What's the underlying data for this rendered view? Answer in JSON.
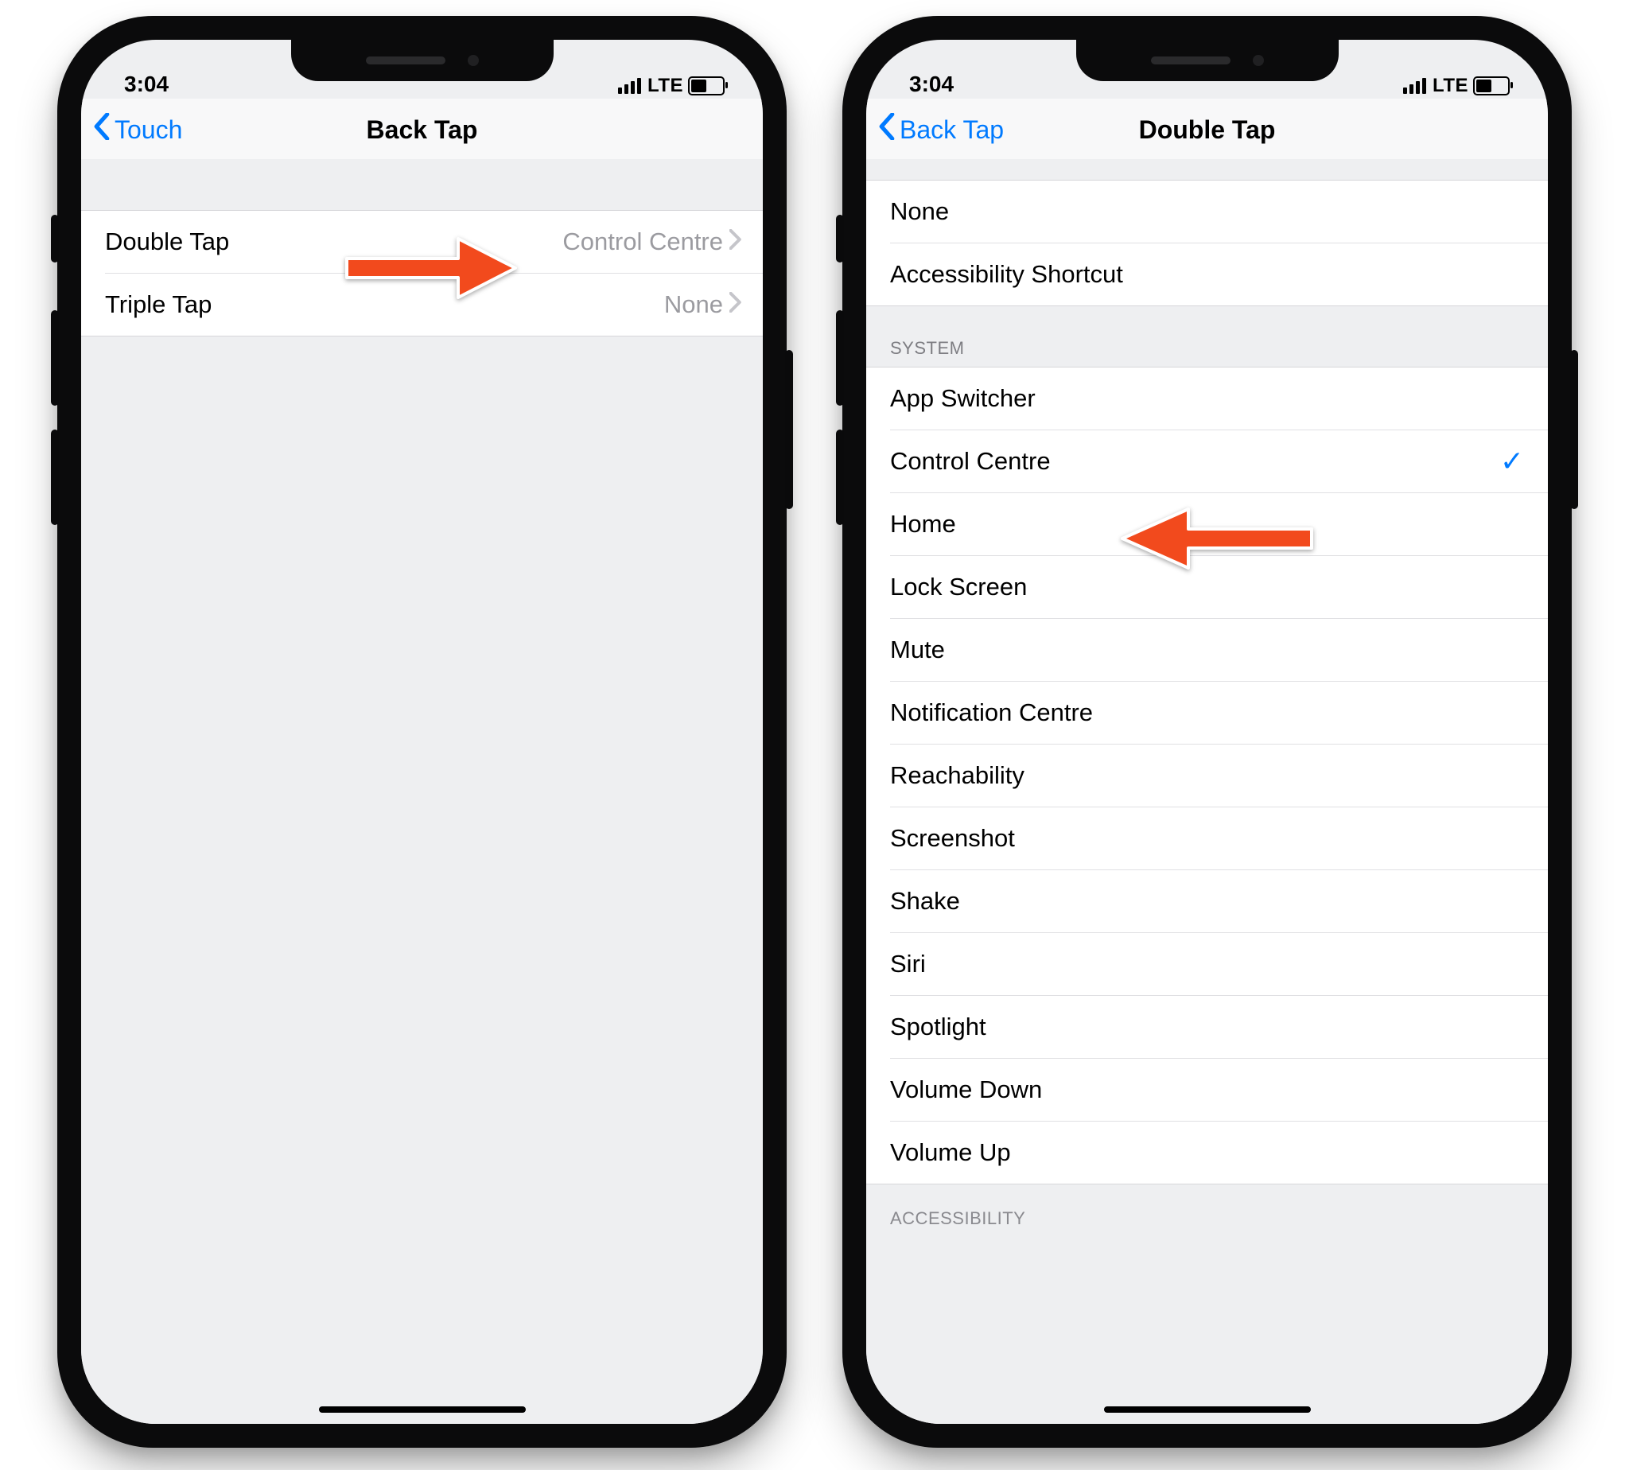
{
  "status": {
    "time": "3:04",
    "carrier": "LTE"
  },
  "colors": {
    "link": "#007aff",
    "arrow": "#f24a1d"
  },
  "left": {
    "nav": {
      "back": "Touch",
      "title": "Back Tap"
    },
    "rows": [
      {
        "label": "Double Tap",
        "value": "Control Centre"
      },
      {
        "label": "Triple Tap",
        "value": "None"
      }
    ]
  },
  "right": {
    "nav": {
      "back": "Back Tap",
      "title": "Double Tap"
    },
    "top_rows": [
      {
        "label": "None"
      },
      {
        "label": "Accessibility Shortcut"
      }
    ],
    "system_header": "System",
    "system_rows": [
      {
        "label": "App Switcher"
      },
      {
        "label": "Control Centre",
        "checked": true
      },
      {
        "label": "Home"
      },
      {
        "label": "Lock Screen"
      },
      {
        "label": "Mute"
      },
      {
        "label": "Notification Centre"
      },
      {
        "label": "Reachability"
      },
      {
        "label": "Screenshot"
      },
      {
        "label": "Shake"
      },
      {
        "label": "Siri"
      },
      {
        "label": "Spotlight"
      },
      {
        "label": "Volume Down"
      },
      {
        "label": "Volume Up"
      }
    ],
    "accessibility_header": "Accessibility"
  }
}
